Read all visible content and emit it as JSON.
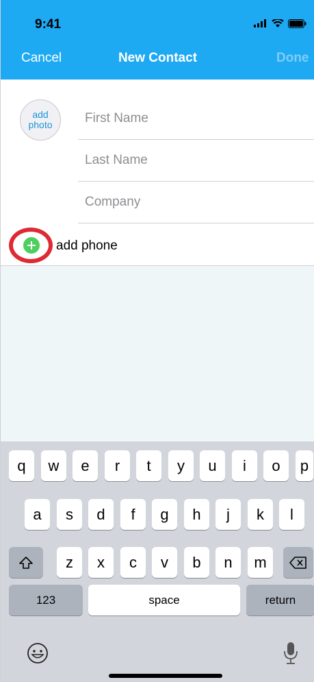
{
  "status_bar": {
    "time": "9:41"
  },
  "nav": {
    "cancel": "Cancel",
    "title": "New Contact",
    "done": "Done"
  },
  "photo": {
    "label_line1": "add",
    "label_line2": "photo"
  },
  "form": {
    "first_name_placeholder": "First Name",
    "last_name_placeholder": "Last Name",
    "company_placeholder": "Company"
  },
  "phone": {
    "add_label": "add phone"
  },
  "keyboard": {
    "row1": [
      "q",
      "w",
      "e",
      "r",
      "t",
      "y",
      "u",
      "i",
      "o",
      "p"
    ],
    "row2": [
      "a",
      "s",
      "d",
      "f",
      "g",
      "h",
      "j",
      "k",
      "l"
    ],
    "row3": [
      "z",
      "x",
      "c",
      "v",
      "b",
      "n",
      "m"
    ],
    "numbers_key": "123",
    "space_key": "space",
    "return_key": "return"
  },
  "colors": {
    "header": "#1ea9f3",
    "add_button": "#4ccf5d",
    "highlight_ring": "#dd2a33",
    "photo_text": "#1993d6"
  }
}
